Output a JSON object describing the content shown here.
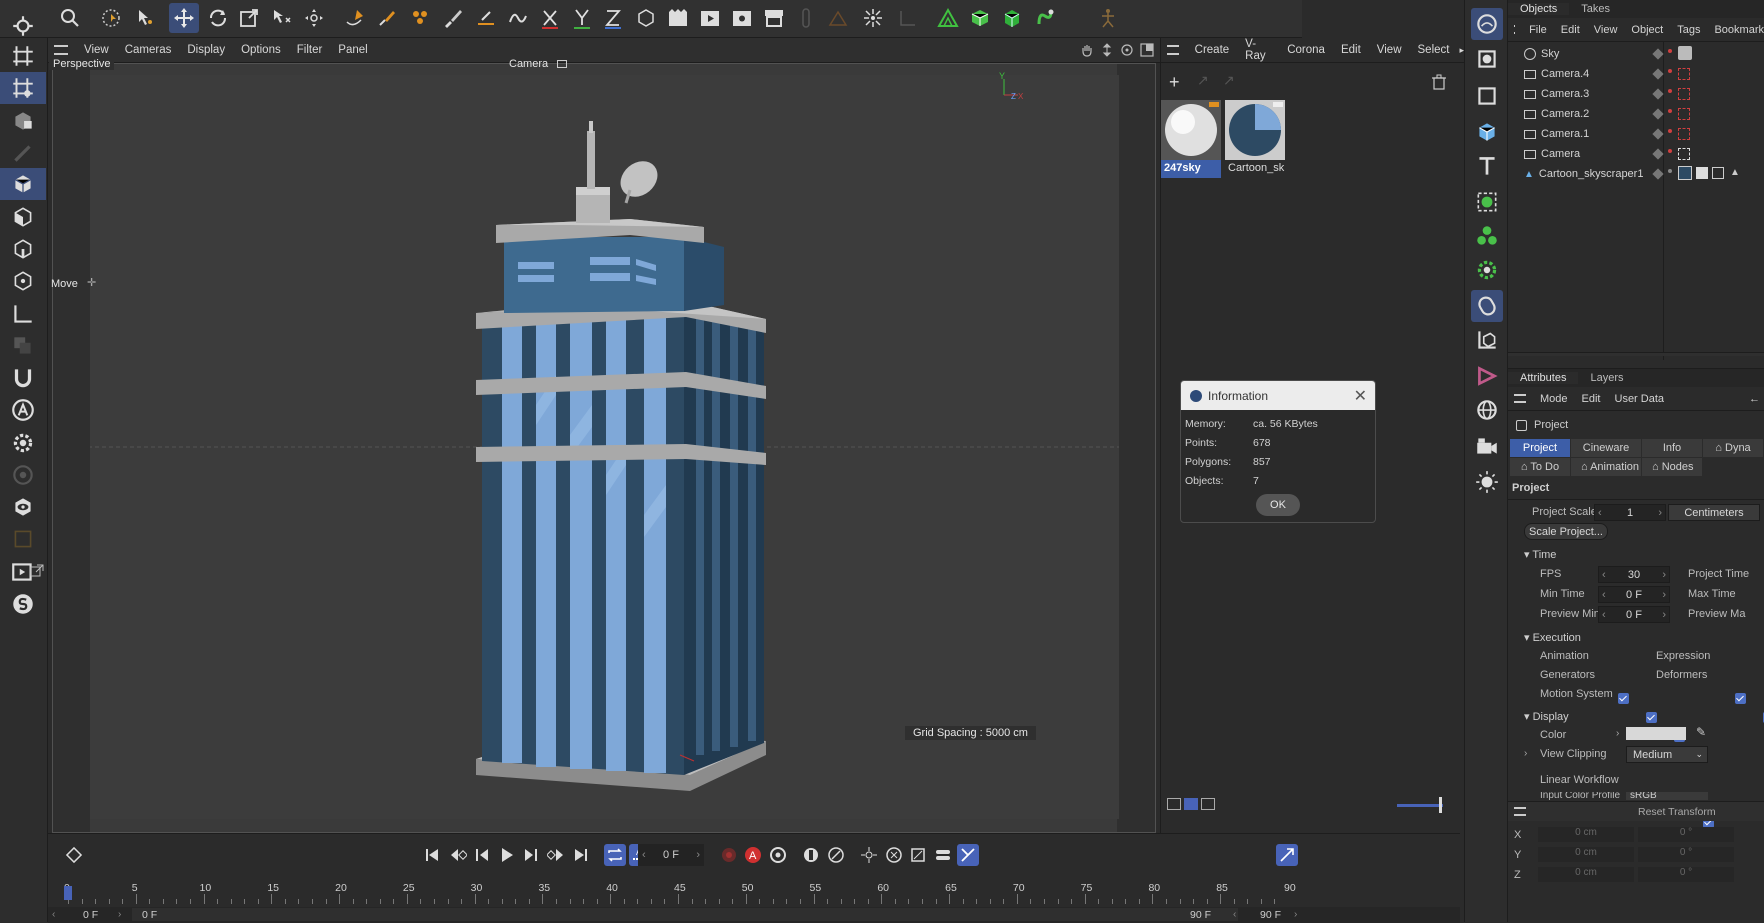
{
  "viewport_menu": [
    "View",
    "Cameras",
    "Display",
    "Options",
    "Filter",
    "Panel"
  ],
  "viewport": {
    "view_name": "Perspective",
    "camera_label": "Camera",
    "move_label": "Move",
    "grid_spacing": "Grid Spacing : 5000 cm",
    "axis_y": "Y",
    "axis_z": "Z",
    "axis_x": "X"
  },
  "material_menu": [
    "Create",
    "V-Ray",
    "Corona",
    "Edit",
    "View",
    "Select"
  ],
  "materials": [
    {
      "name": "247sky"
    },
    {
      "name": "Cartoon_sk"
    }
  ],
  "objects_panel": {
    "tabs": [
      "Objects",
      "Takes"
    ],
    "menu": [
      "File",
      "Edit",
      "View",
      "Object",
      "Tags",
      "Bookmark"
    ],
    "items": [
      "Sky",
      "Camera.4",
      "Camera.3",
      "Camera.2",
      "Camera.1",
      "Camera",
      "Cartoon_skyscraper1"
    ]
  },
  "attributes": {
    "tabs": [
      "Attributes",
      "Layers"
    ],
    "menu": [
      "Mode",
      "Edit",
      "User Data"
    ],
    "object": "Project",
    "btabs_row1": [
      "Project",
      "Cineware",
      "Info",
      "Dyna"
    ],
    "btabs_row2": [
      "To Do",
      "Animation",
      "Nodes"
    ],
    "section_title": "Project",
    "project_scale_label": "Project Scale",
    "project_scale_value": "1",
    "project_scale_unit": "Centimeters",
    "scale_project_btn": "Scale Project...",
    "time_header": "Time",
    "fps_label": "FPS",
    "fps_value": "30",
    "project_time_label": "Project Time",
    "min_time_label": "Min Time",
    "min_time_value": "0 F",
    "max_time_label": "Max Time",
    "preview_min_label": "Preview Min",
    "preview_min_value": "0 F",
    "preview_max_label": "Preview Ma",
    "execution_header": "Execution",
    "animation_label": "Animation",
    "expression_label": "Expression",
    "generators_label": "Generators",
    "deformers_label": "Deformers",
    "motion_label": "Motion System",
    "display_header": "Display",
    "color_label": "Color",
    "view_clipping_label": "View Clipping",
    "view_clipping_value": "Medium",
    "linear_workflow_label": "Linear Workflow",
    "input_color_label": "Input Color Profile",
    "input_color_value": "sRGB",
    "reset_transform": "Reset Transform",
    "coord_x": "X",
    "coord_y": "Y",
    "coord_z": "Z",
    "coord_cm": "0 cm",
    "coord_deg": "0 °"
  },
  "dialog": {
    "title": "Information",
    "rows": [
      {
        "label": "Memory:",
        "value": "ca. 56 KBytes"
      },
      {
        "label": "Points:",
        "value": "678"
      },
      {
        "label": "Polygons:",
        "value": "857"
      },
      {
        "label": "Objects:",
        "value": "7"
      }
    ],
    "ok": "OK"
  },
  "timeline": {
    "current_frame": "0 F",
    "ticks": [
      "0",
      "5",
      "10",
      "15",
      "20",
      "25",
      "30",
      "35",
      "40",
      "45",
      "50",
      "55",
      "60",
      "65",
      "70",
      "75",
      "80",
      "85",
      "90"
    ],
    "start_field": "0 F",
    "start_field2": "0 F",
    "end_field": "90 F",
    "end_field2": "90 F"
  },
  "colors": {
    "accent": "#3d5ea8",
    "bg": "#2b2b2b",
    "viewport": "#3c3c3c",
    "building_dark": "#2d4a63",
    "building_light": "#7fa8d8"
  }
}
